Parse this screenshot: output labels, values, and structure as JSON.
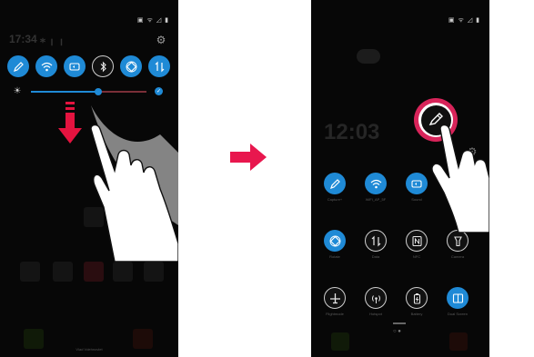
{
  "left_phone": {
    "status_icons": "▣ ᯤ ◿ ▮",
    "faded_time": "17:34 ⁎ ╷ ╷",
    "settings_icon": "gear-icon",
    "quick_toggles": [
      {
        "name": "edit",
        "icon": "pencil-icon",
        "state": "on"
      },
      {
        "name": "wifi",
        "icon": "wifi-icon",
        "state": "on"
      },
      {
        "name": "sound",
        "icon": "speaker-icon",
        "state": "on"
      },
      {
        "name": "bluetooth",
        "icon": "bluetooth-icon",
        "state": "off"
      },
      {
        "name": "rotation",
        "icon": "rotate-icon",
        "state": "on"
      },
      {
        "name": "data",
        "icon": "data-arrows-icon",
        "state": "on"
      }
    ],
    "brightness_level": 0.58,
    "auto_brightness": "on",
    "home_label": "Vlad Vdehnovlet"
  },
  "right_phone": {
    "status_icons": "▣ ᯤ ◿ ▮",
    "faded_time": "12:03",
    "highlighted_action": "pencil-edit",
    "quick_settings": [
      {
        "label": "Capture+",
        "icon": "pencil-icon",
        "state": "on"
      },
      {
        "label": "WiFi_AP_5F",
        "icon": "wifi-icon",
        "state": "on"
      },
      {
        "label": "Sound",
        "icon": "speaker-icon",
        "state": "on"
      },
      {
        "label": "Bluetooth",
        "icon": "bluetooth-icon",
        "state": "on"
      },
      {
        "label": "Rotate",
        "icon": "rotate-icon",
        "state": "on"
      },
      {
        "label": "Data",
        "icon": "data-arrows-icon",
        "state": "off"
      },
      {
        "label": "NFC",
        "icon": "nfc-icon",
        "state": "off"
      },
      {
        "label": "Camera",
        "icon": "flashlight-icon",
        "state": "off"
      },
      {
        "label": "Flightmode",
        "icon": "airplane-icon",
        "state": "off"
      },
      {
        "label": "Hotspot",
        "icon": "hotspot-icon",
        "state": "off"
      },
      {
        "label": "Battery",
        "icon": "battery-icon",
        "state": "off"
      },
      {
        "label": "Dual Screen",
        "icon": "dual-screen-icon",
        "state": "on"
      }
    ]
  },
  "colors": {
    "accent": "#1f8ad6",
    "highlight_ring": "#d8245a",
    "arrow": "#e8174e",
    "down_arrow": "#e4133f"
  }
}
